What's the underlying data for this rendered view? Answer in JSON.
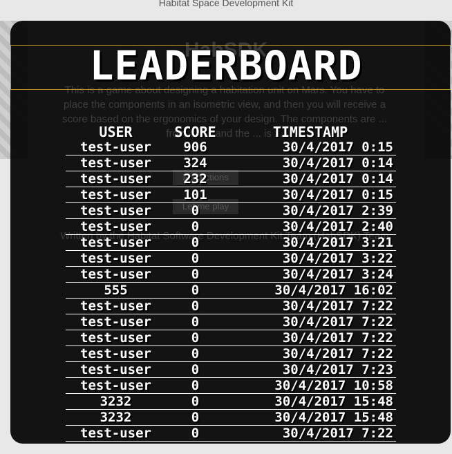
{
  "app": {
    "header_title": "Habitat Space Development Kit",
    "heading": "HabSDK",
    "description": "This is a game about designing a habitation unit on Mars. You have to place the components in an isometric view, and then you will receive a score based on the ergonomics of your design. The components are ... from a s... and the ... is ...",
    "button_instructions": "Instructions",
    "button_play": "Let me play",
    "credit": "Written by the Habitat Software Development Kit Team (HabSDK) Team"
  },
  "leaderboard": {
    "title": "LEADERBOARD",
    "columns": {
      "user": "USER",
      "score": "SCORE",
      "timestamp": "TIMESTAMP"
    },
    "rows": [
      {
        "user": "test-user",
        "score": "906",
        "timestamp": "30/4/2017 0:15"
      },
      {
        "user": "test-user",
        "score": "324",
        "timestamp": "30/4/2017 0:14"
      },
      {
        "user": "test-user",
        "score": "232",
        "timestamp": "30/4/2017 0:14"
      },
      {
        "user": "test-user",
        "score": "101",
        "timestamp": "30/4/2017 0:15"
      },
      {
        "user": "test-user",
        "score": "0",
        "timestamp": "30/4/2017 2:39"
      },
      {
        "user": "test-user",
        "score": "0",
        "timestamp": "30/4/2017 2:40"
      },
      {
        "user": "test-user",
        "score": "0",
        "timestamp": "30/4/2017 3:21"
      },
      {
        "user": "test-user",
        "score": "0",
        "timestamp": "30/4/2017 3:22"
      },
      {
        "user": "test-user",
        "score": "0",
        "timestamp": "30/4/2017 3:24"
      },
      {
        "user": "555",
        "score": "0",
        "timestamp": "30/4/2017 16:02"
      },
      {
        "user": "test-user",
        "score": "0",
        "timestamp": "30/4/2017 7:22"
      },
      {
        "user": "test-user",
        "score": "0",
        "timestamp": "30/4/2017 7:22"
      },
      {
        "user": "test-user",
        "score": "0",
        "timestamp": "30/4/2017 7:22"
      },
      {
        "user": "test-user",
        "score": "0",
        "timestamp": "30/4/2017 7:22"
      },
      {
        "user": "test-user",
        "score": "0",
        "timestamp": "30/4/2017 7:23"
      },
      {
        "user": "test-user",
        "score": "0",
        "timestamp": "30/4/2017 10:58"
      },
      {
        "user": "3232",
        "score": "0",
        "timestamp": "30/4/2017 15:48"
      },
      {
        "user": "3232",
        "score": "0",
        "timestamp": "30/4/2017 15:48"
      },
      {
        "user": "test-user",
        "score": "0",
        "timestamp": "30/4/2017 7:22"
      }
    ]
  }
}
